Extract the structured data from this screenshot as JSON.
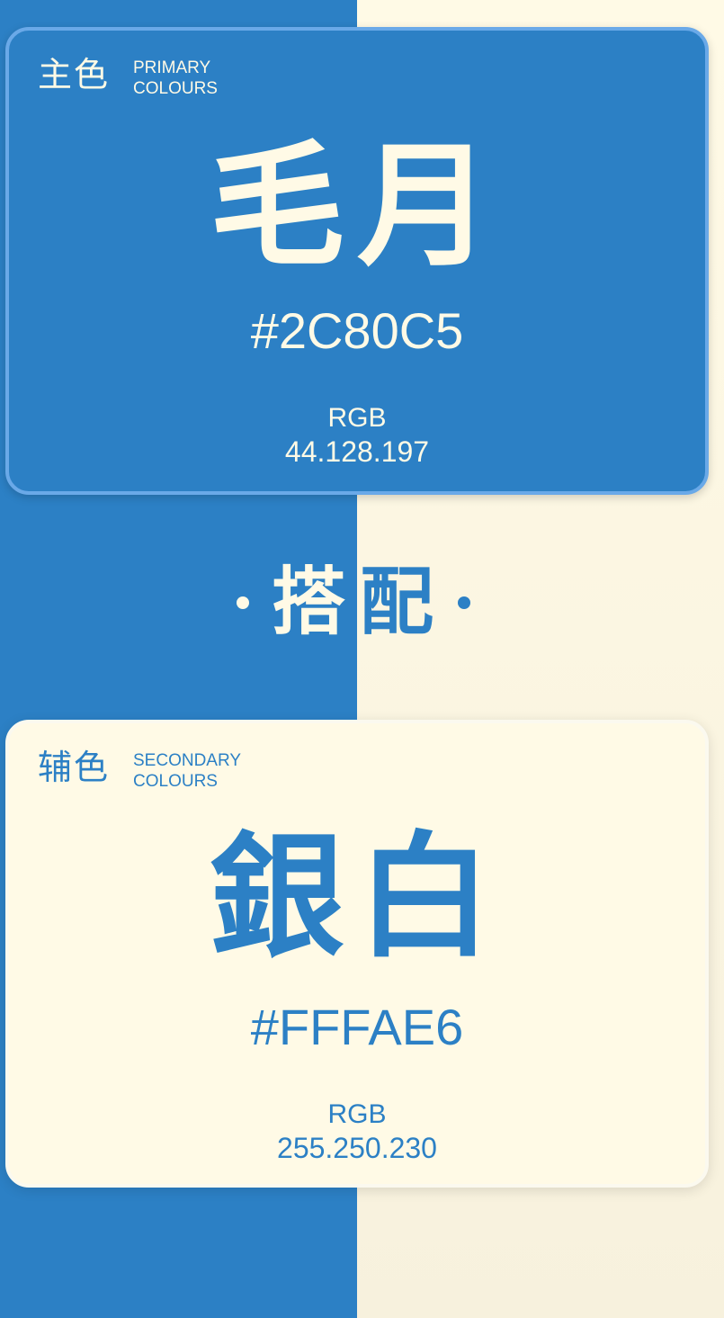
{
  "colors": {
    "primary": "#2C80C5",
    "secondary": "#FFFAE6"
  },
  "primary_card": {
    "label_cn": "主色",
    "label_en_line1": "PRIMARY",
    "label_en_line2": "COLOURS",
    "name": "毛月",
    "hex": "#2C80C5",
    "rgb_label": "RGB",
    "rgb_value": "44.128.197"
  },
  "pairing": {
    "char1": "搭",
    "char2": "配"
  },
  "secondary_card": {
    "label_cn": "辅色",
    "label_en_line1": "SECONDARY",
    "label_en_line2": "COLOURS",
    "name": "銀白",
    "hex": "#FFFAE6",
    "rgb_label": "RGB",
    "rgb_value": "255.250.230"
  }
}
